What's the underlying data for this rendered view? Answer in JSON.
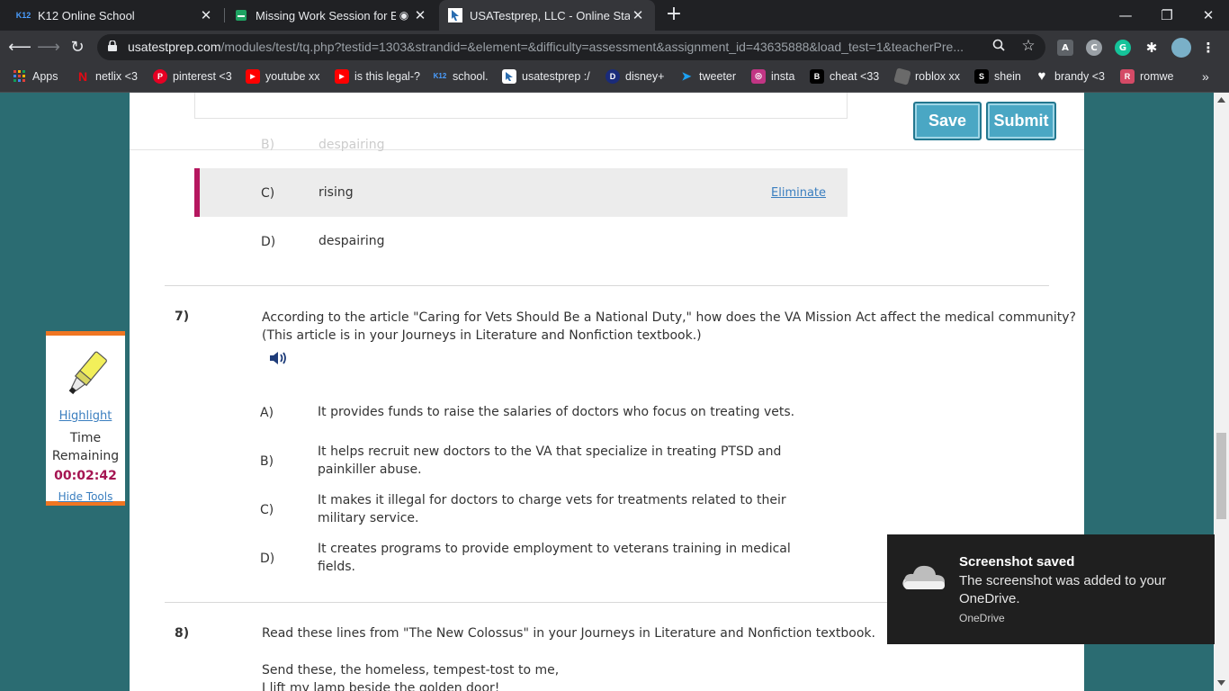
{
  "browser": {
    "tabs": [
      {
        "title": "K12 Online School",
        "icon": "k12-icon",
        "favicon_text": "K12"
      },
      {
        "title": "Missing Work Session for EL/",
        "icon": "docs-icon"
      },
      {
        "title": "USATestprep, LLC - Online State-S",
        "icon": "usatestprep-icon"
      }
    ],
    "url_host": "usatestprep.com",
    "url_path": "/modules/test/tq.php?testid=1303&strandid=&element=&difficulty=assessment&assignment_id=43635888&load_test=1&teacherPre...",
    "bookmarks": [
      {
        "label": "Apps",
        "icon": "apps-grid-icon",
        "color": "#e0403a"
      },
      {
        "label": "netlix <3",
        "icon": "netflix-icon",
        "color": "#e50914",
        "glyph": "N"
      },
      {
        "label": "pinterest <3",
        "icon": "pinterest-icon",
        "color": "#e60023",
        "glyph": "P"
      },
      {
        "label": "youtube xx",
        "icon": "youtube-icon",
        "color": "#ff0000",
        "glyph": "▶"
      },
      {
        "label": "is this legal-?",
        "icon": "youtube-icon",
        "color": "#ff0000",
        "glyph": "▶"
      },
      {
        "label": "school.",
        "icon": "k12-icon",
        "color": "#35363a",
        "glyph": "K12"
      },
      {
        "label": "usatestprep :/",
        "icon": "usatestprep-icon",
        "color": "#ffffff",
        "glyph": ""
      },
      {
        "label": "disney+",
        "icon": "disney-icon",
        "color": "#1a2b7a",
        "glyph": "D"
      },
      {
        "label": "tweeter",
        "icon": "twitter-icon",
        "color": "#1da1f2",
        "glyph": "t"
      },
      {
        "label": "insta",
        "icon": "instagram-icon",
        "color": "#c13584",
        "glyph": "◎"
      },
      {
        "label": "cheat <33",
        "icon": "bold-b-icon",
        "color": "#000000",
        "glyph": "B"
      },
      {
        "label": "roblox xx",
        "icon": "roblox-icon",
        "color": "#5a5a5a",
        "glyph": ""
      },
      {
        "label": "shein",
        "icon": "shein-icon",
        "color": "#000000",
        "glyph": "S"
      },
      {
        "label": "brandy <3",
        "icon": "heart-icon",
        "color": "#35363a",
        "glyph": "♥"
      },
      {
        "label": "romwe",
        "icon": "romwe-icon",
        "color": "#d44a66",
        "glyph": "R"
      }
    ]
  },
  "test": {
    "save_label": "Save",
    "submit_label": "Submit",
    "prev_question": {
      "answer_c": {
        "letter": "C)",
        "text": "rising"
      },
      "answer_d": {
        "letter": "D)",
        "text": "despairing"
      },
      "eliminate_label": "Eliminate"
    },
    "q7": {
      "number": "7)",
      "line1": "According to the article \"Caring for Vets Should Be a National Duty,\" how does the VA Mission Act affect the medical community?",
      "line2": "(This article is in your Journeys in Literature and Nonfiction textbook.)",
      "answers": [
        {
          "letter": "A)",
          "line1": "It provides funds to raise the salaries of doctors who focus on treating vets.",
          "line2": ""
        },
        {
          "letter": "B)",
          "line1": "It helps recruit new doctors to the VA that specialize in treating PTSD and",
          "line2": "painkiller abuse."
        },
        {
          "letter": "C)",
          "line1": "It makes it illegal for doctors to charge vets for treatments related to their",
          "line2": "military service."
        },
        {
          "letter": "D)",
          "line1": "It creates programs to provide employment to veterans training in medical",
          "line2": "fields."
        }
      ]
    },
    "q8": {
      "number": "8)",
      "line1": "Read these lines from \"The New Colossus\" in your Journeys in Literature and Nonfiction textbook.",
      "poem1": "Send these, the homeless, tempest-tost to me,",
      "poem2": "I lift my lamp beside the golden door!"
    }
  },
  "tools": {
    "highlight_label": "Highlight",
    "time_label_1": "Time",
    "time_label_2": "Remaining",
    "timer": "00:02:42",
    "hide_label": "Hide Tools"
  },
  "toast": {
    "title": "Screenshot saved",
    "body": "The screenshot was added to your OneDrive.",
    "source": "OneDrive"
  },
  "colors": {
    "background": "#2b6c72",
    "accent_blue": "#4aa7c4",
    "highlight_bar": "#b5175f",
    "timer": "#a51552",
    "tools_border": "#f07622"
  }
}
